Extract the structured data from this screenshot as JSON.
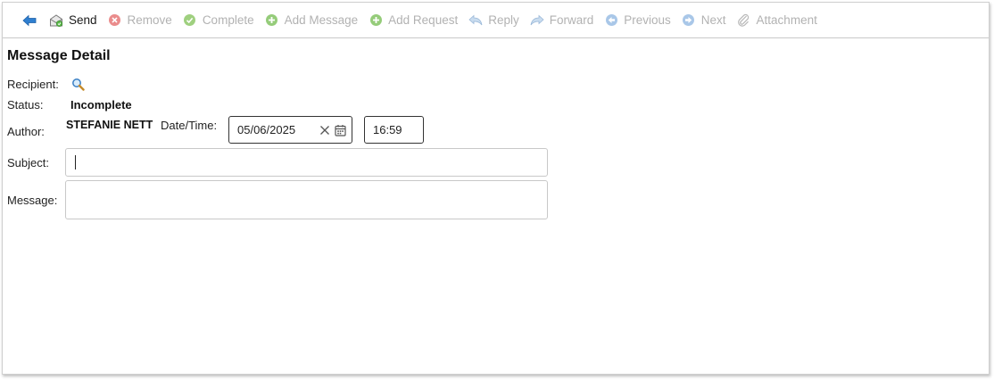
{
  "toolbar": {
    "back": {
      "icon": "back-arrow-icon"
    },
    "buttons": [
      {
        "key": "send",
        "label": "Send",
        "icon": "send-icon",
        "enabled": true
      },
      {
        "key": "remove",
        "label": "Remove",
        "icon": "remove-icon",
        "enabled": false
      },
      {
        "key": "complete",
        "label": "Complete",
        "icon": "complete-icon",
        "enabled": false
      },
      {
        "key": "add_message",
        "label": "Add Message",
        "icon": "add-message-icon",
        "enabled": false
      },
      {
        "key": "add_request",
        "label": "Add Request",
        "icon": "add-request-icon",
        "enabled": false
      },
      {
        "key": "reply",
        "label": "Reply",
        "icon": "reply-icon",
        "enabled": false
      },
      {
        "key": "forward",
        "label": "Forward",
        "icon": "forward-icon",
        "enabled": false
      },
      {
        "key": "previous",
        "label": "Previous",
        "icon": "previous-icon",
        "enabled": false
      },
      {
        "key": "next",
        "label": "Next",
        "icon": "next-icon",
        "enabled": false
      },
      {
        "key": "attachment",
        "label": "Attachment",
        "icon": "attachment-icon",
        "enabled": false
      }
    ]
  },
  "form": {
    "title": "Message Detail",
    "recipient_label": "Recipient:",
    "status_label": "Status:",
    "status_value": "Incomplete",
    "author_label": "Author:",
    "author_value": "STEFANIE NETT",
    "datetime_label": "Date/Time:",
    "date_value": "05/06/2025",
    "time_value": "16:59",
    "subject_label": "Subject:",
    "subject_value": "",
    "message_label": "Message:",
    "message_value": ""
  },
  "colors": {
    "accent_blue": "#3b82c8",
    "remove_red": "#e06b6b",
    "complete_green": "#8fcf6a",
    "add_green": "#7cc35f",
    "disabled_text": "#b2b2b2"
  }
}
